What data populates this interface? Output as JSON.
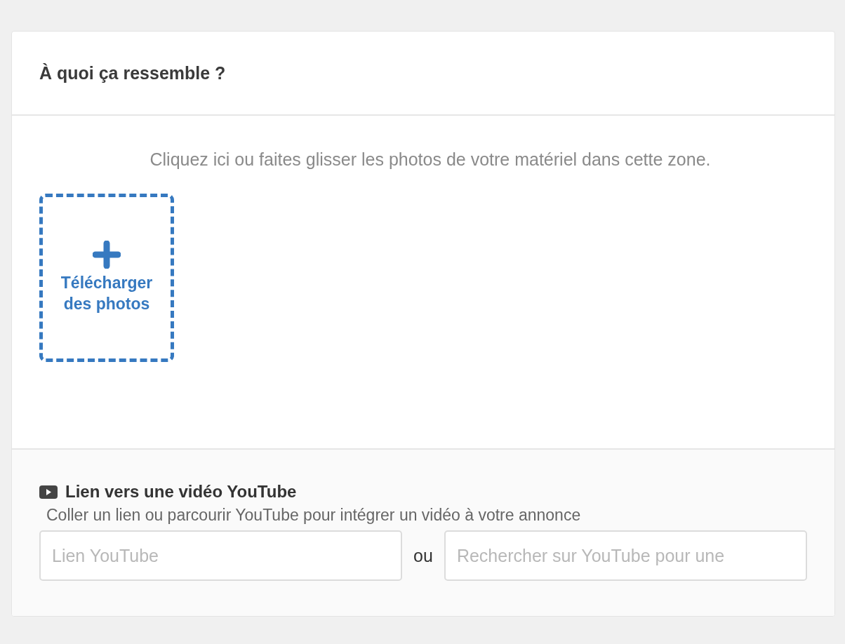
{
  "card": {
    "title": "À quoi ça ressemble ?"
  },
  "upload": {
    "hint": "Cliquez ici ou faites glisser les photos de votre matériel dans cette zone.",
    "button_label": "Télécharger des photos"
  },
  "video": {
    "title": "Lien vers une vidéo YouTube",
    "description": "Coller un lien ou parcourir YouTube pour intégrer un vidéo à votre annonce",
    "link_field": {
      "placeholder": "Lien YouTube"
    },
    "separator": "ou",
    "search_field": {
      "placeholder": "Rechercher sur YouTube pour une"
    }
  }
}
